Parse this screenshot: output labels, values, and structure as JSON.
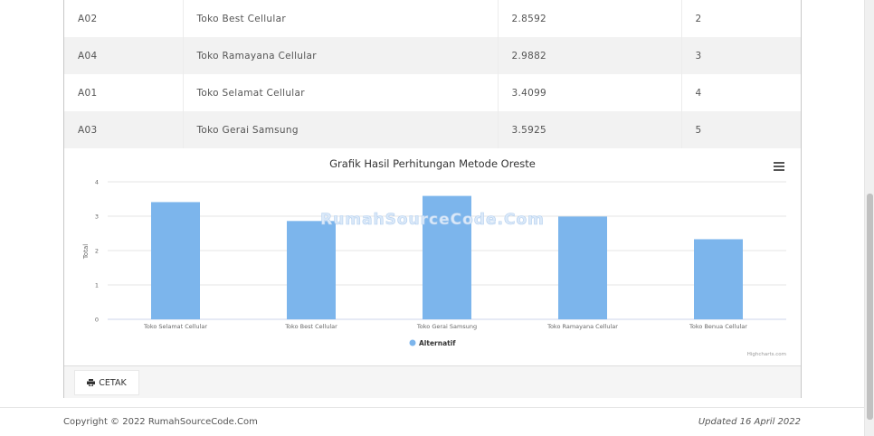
{
  "table": {
    "rows": [
      {
        "code": "A02",
        "name": "Toko Best Cellular",
        "value": "2.8592",
        "rank": "2"
      },
      {
        "code": "A04",
        "name": "Toko Ramayana Cellular",
        "value": "2.9882",
        "rank": "3"
      },
      {
        "code": "A01",
        "name": "Toko Selamat Cellular",
        "value": "3.4099",
        "rank": "4"
      },
      {
        "code": "A03",
        "name": "Toko Gerai Samsung",
        "value": "3.5925",
        "rank": "5"
      }
    ]
  },
  "chart_data": {
    "type": "bar",
    "title": "Grafik Hasil Perhitungan Metode Oreste",
    "xlabel": "",
    "ylabel": "Total",
    "ylim": [
      0,
      4
    ],
    "yticks": [
      "0",
      "1",
      "2",
      "3",
      "4"
    ],
    "categories": [
      "Toko Selamat Cellular",
      "Toko Best Cellular",
      "Toko Gerai Samsung",
      "Toko Ramayana Cellular",
      "Toko Benua Cellular"
    ],
    "series": [
      {
        "name": "Alternatif",
        "values": [
          3.41,
          2.86,
          3.59,
          2.99,
          2.33
        ],
        "color": "#7cb5ec"
      }
    ],
    "grid": true,
    "legend": "bottom-center",
    "credits": "Highcharts.com",
    "watermark": "RumahSourceCode.Com"
  },
  "actions": {
    "print_label": "CETAK"
  },
  "footer": {
    "copyright": "Copyright © 2022 RumahSourceCode.Com",
    "updated": "Updated 16 April 2022"
  },
  "icons": {
    "print": "print-icon",
    "menu": "hamburger-menu-icon"
  }
}
